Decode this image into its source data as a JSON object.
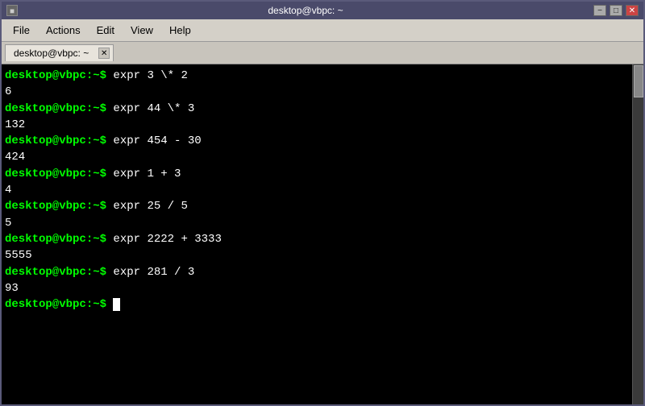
{
  "window": {
    "top_title": "desktop@vbpc: ~",
    "tab_title": "desktop@vbpc: ~",
    "icon": "□"
  },
  "menu": {
    "items": [
      "File",
      "Actions",
      "Edit",
      "View",
      "Help"
    ]
  },
  "terminal": {
    "lines": [
      {
        "type": "prompt",
        "prompt": "desktop@vbpc:~$",
        "command": " expr 3 \\* 2"
      },
      {
        "type": "output",
        "text": "6"
      },
      {
        "type": "prompt",
        "prompt": "desktop@vbpc:~$",
        "command": " expr 44 \\* 3"
      },
      {
        "type": "output",
        "text": "132"
      },
      {
        "type": "prompt",
        "prompt": "desktop@vbpc:~$",
        "command": " expr 454 - 30"
      },
      {
        "type": "output",
        "text": "424"
      },
      {
        "type": "prompt",
        "prompt": "desktop@vbpc:~$",
        "command": " expr 1 + 3"
      },
      {
        "type": "output",
        "text": "4"
      },
      {
        "type": "prompt",
        "prompt": "desktop@vbpc:~$",
        "command": " expr 25 / 5"
      },
      {
        "type": "output",
        "text": "5"
      },
      {
        "type": "prompt",
        "prompt": "desktop@vbpc:~$",
        "command": " expr 2222 + 3333"
      },
      {
        "type": "output",
        "text": "5555"
      },
      {
        "type": "prompt",
        "prompt": "desktop@vbpc:~$",
        "command": " expr 281 / 3"
      },
      {
        "type": "output",
        "text": "93"
      },
      {
        "type": "prompt_cursor",
        "prompt": "desktop@vbpc:~$",
        "command": " "
      }
    ]
  },
  "controls": {
    "minimize": "−",
    "maximize": "□",
    "close": "✕"
  }
}
